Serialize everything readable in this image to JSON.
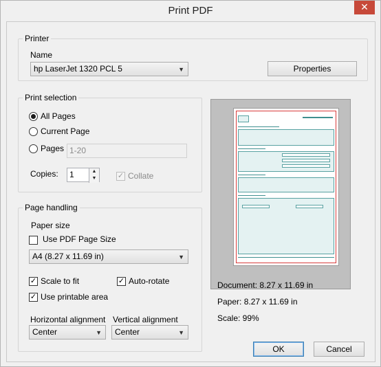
{
  "window": {
    "title": "Print PDF",
    "close_glyph": "✕"
  },
  "printer": {
    "group_label": "Printer",
    "name_label": "Name",
    "selected_printer": "hp LaserJet 1320 PCL 5",
    "properties_button": "Properties"
  },
  "print_selection": {
    "group_label": "Print selection",
    "all_pages": {
      "label": "All Pages",
      "selected": true
    },
    "current_page": {
      "label": "Current Page",
      "selected": false
    },
    "pages": {
      "label": "Pages",
      "selected": false,
      "value": "1-20"
    },
    "copies_label": "Copies:",
    "copies_value": "1",
    "collate": {
      "label": "Collate",
      "checked": true,
      "enabled": false
    }
  },
  "page_handling": {
    "group_label": "Page handling",
    "paper_size_label": "Paper size",
    "use_pdf_page_size": {
      "label": "Use PDF Page Size",
      "checked": false
    },
    "paper_size_value": "A4 (8.27 x 11.69 in)",
    "scale_to_fit": {
      "label": "Scale to fit",
      "checked": true
    },
    "auto_rotate": {
      "label": "Auto-rotate",
      "checked": true
    },
    "use_printable_area": {
      "label": "Use printable area",
      "checked": true
    },
    "horizontal_alignment_label": "Horizontal alignment",
    "horizontal_alignment_value": "Center",
    "vertical_alignment_label": "Vertical alignment",
    "vertical_alignment_value": "Center"
  },
  "preview_info": {
    "document": "Document: 8.27 x 11.69 in",
    "paper": "Paper: 8.27 x 11.69 in",
    "scale": "Scale: 99%"
  },
  "buttons": {
    "ok": "OK",
    "cancel": "Cancel"
  },
  "icons": {
    "dropdown": "▼",
    "spin_up": "▲",
    "spin_down": "▼",
    "check": "✓"
  },
  "colors": {
    "close_button": "#c7493a",
    "preview_margin": "#d83a3a",
    "document_accent": "#3e8f8f"
  }
}
